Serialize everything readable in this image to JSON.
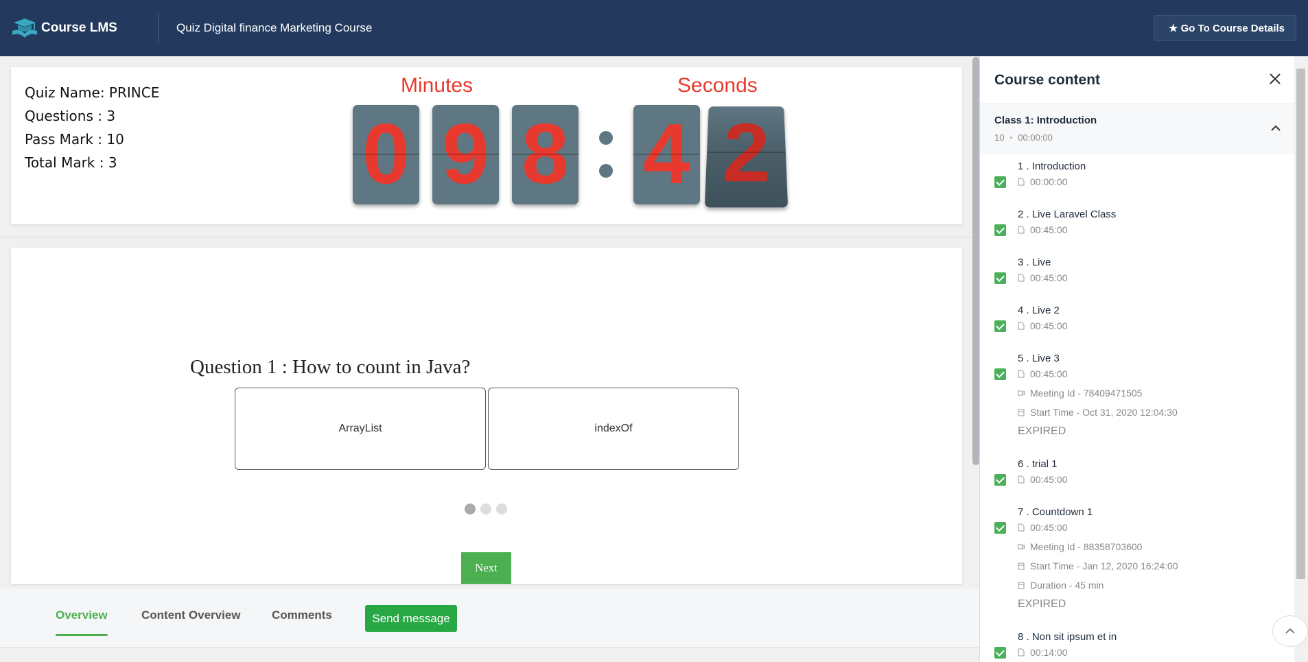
{
  "header": {
    "logo_text": "Course LMS",
    "title": "Quiz Digital finance Marketing Course",
    "course_button": "★ Go To Course Details"
  },
  "quiz": {
    "name": "Quiz Name: PRINCE",
    "questions": "Questions : 3",
    "pass_mark": "Pass Mark : 10",
    "total_mark": "Total Mark : 3"
  },
  "timer": {
    "minutes_label": "Minutes",
    "seconds_label": "Seconds",
    "minutes_digits": [
      "0",
      "9",
      "8"
    ],
    "seconds_digits": [
      "4",
      "2"
    ]
  },
  "question": {
    "text": "Question 1 : How to count in Java?",
    "options": [
      "ArrayList",
      "indexOf"
    ],
    "next_label": "Next",
    "current_slide": 1,
    "total_slides": 3
  },
  "tabs": {
    "items": [
      {
        "label": "Overview",
        "active": true
      },
      {
        "label": "Content Overview",
        "active": false
      },
      {
        "label": "Comments",
        "active": false
      }
    ],
    "send_message": "Send message"
  },
  "sidebar": {
    "title": "Course content",
    "section": {
      "title": "Class 1: Introduction",
      "count": "10",
      "duration": "00:00:00"
    },
    "lessons": [
      {
        "title": "1 . Introduction",
        "duration": "00:00:00"
      },
      {
        "title": "2 . Live Laravel Class",
        "duration": "00:45:00"
      },
      {
        "title": "3 . Live",
        "duration": "00:45:00"
      },
      {
        "title": "4 . Live 2",
        "duration": "00:45:00"
      },
      {
        "title": "5 . Live 3",
        "duration": "00:45:00",
        "meeting": "Meeting Id - 78409471505",
        "start": "Start Time - Oct 31, 2020 12:04:30",
        "status": "EXPIRED"
      },
      {
        "title": "6 . trial 1",
        "duration": "00:45:00"
      },
      {
        "title": "7 . Countdown 1",
        "duration": "00:45:00",
        "meeting": "Meeting Id - 88358703600",
        "start": "Start Time - Jan 12, 2020 16:24:00",
        "duration_note": "Duration - 45 min",
        "status": "EXPIRED"
      },
      {
        "title": "8 . Non sit ipsum et in",
        "duration": "00:14:00"
      }
    ]
  },
  "colors": {
    "header_bg": "#233a5e",
    "accent_green": "#4caf50",
    "timer_red": "#e8392e",
    "digit_bg": "#5f7783"
  }
}
